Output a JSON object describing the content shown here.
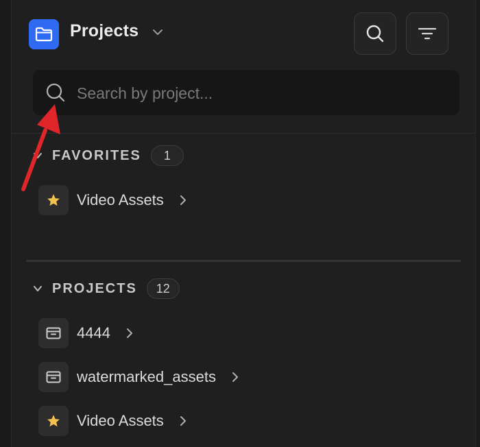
{
  "header": {
    "title": "Projects",
    "icons": {
      "folder": "folder-icon",
      "dropdown": "chevron-down-icon",
      "search_button": "search-icon",
      "filter_button": "filter-icon"
    }
  },
  "search": {
    "placeholder": "Search by project...",
    "value": ""
  },
  "favorites": {
    "title": "FAVORITES",
    "count": "1",
    "items": [
      {
        "label": "Video Assets",
        "icon": "star-icon"
      }
    ]
  },
  "projects": {
    "title": "PROJECTS",
    "count": "12",
    "items": [
      {
        "label": "4444",
        "icon": "archive-icon"
      },
      {
        "label": "watermarked_assets",
        "icon": "archive-icon"
      },
      {
        "label": "Video Assets",
        "icon": "star-icon"
      }
    ]
  },
  "colors": {
    "background": "#1f1f1f",
    "folder_accent": "#2f6bf2",
    "star": "#f2c14e",
    "annotation_arrow": "#e0262b"
  }
}
